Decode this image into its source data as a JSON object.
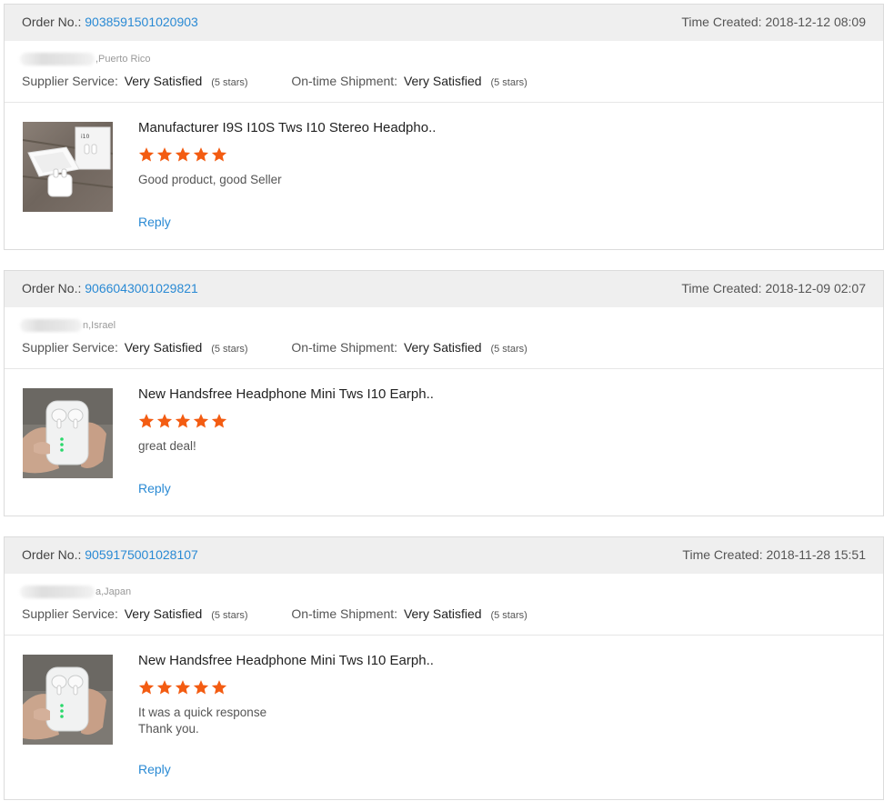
{
  "labels": {
    "order_no": "Order No.:",
    "time_created": "Time Created:",
    "supplier_service": "Supplier Service:",
    "ontime_shipment": "On-time Shipment:",
    "reply": "Reply"
  },
  "colors": {
    "star": "#f35c12",
    "link": "#2a8ad4",
    "header_bg": "#efefef"
  },
  "orders": [
    {
      "order_number": "9038591501020903",
      "time_created": "2018-12-12 08:09",
      "buyer_location": ",Puerto Rico",
      "supplier_service": "Very Satisfied",
      "supplier_stars": "(5 stars)",
      "shipment": "Very Satisfied",
      "shipment_stars": "(5 stars)",
      "product_title": "Manufacturer I9S I10S Tws I10 Stereo Headpho..",
      "rating": 5,
      "comment_lines": [
        "Good product, good Seller"
      ],
      "thumbnail_icon": "earbuds-box-product-image"
    },
    {
      "order_number": "9066043001029821",
      "time_created": "2018-12-09 02:07",
      "buyer_location": "n,Israel",
      "supplier_service": "Very Satisfied",
      "supplier_stars": "(5 stars)",
      "shipment": "Very Satisfied",
      "shipment_stars": "(5 stars)",
      "product_title": "New Handsfree Headphone Mini Tws I10 Earph..",
      "rating": 5,
      "comment_lines": [
        "great deal!"
      ],
      "thumbnail_icon": "earbuds-in-hand-product-image"
    },
    {
      "order_number": "9059175001028107",
      "time_created": "2018-11-28 15:51",
      "buyer_location": "a,Japan",
      "supplier_service": "Very Satisfied",
      "supplier_stars": "(5 stars)",
      "shipment": "Very Satisfied",
      "shipment_stars": "(5 stars)",
      "product_title": "New Handsfree Headphone Mini Tws I10 Earph..",
      "rating": 5,
      "comment_lines": [
        "It was a quick response",
        "Thank you."
      ],
      "thumbnail_icon": "earbuds-in-hand-product-image"
    }
  ]
}
